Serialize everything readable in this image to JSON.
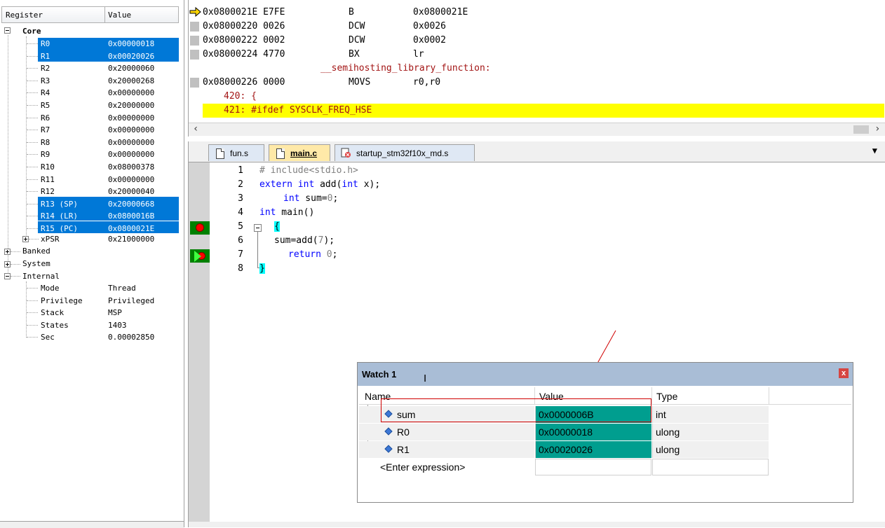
{
  "registers": {
    "headers": {
      "register": "Register",
      "value": "Value"
    },
    "core_label": "Core",
    "core": [
      {
        "name": "R0",
        "value": "0x00000018",
        "selected": true
      },
      {
        "name": "R1",
        "value": "0x00020026",
        "selected": true
      },
      {
        "name": "R2",
        "value": "0x20000060",
        "selected": false
      },
      {
        "name": "R3",
        "value": "0x20000268",
        "selected": false
      },
      {
        "name": "R4",
        "value": "0x00000000",
        "selected": false
      },
      {
        "name": "R5",
        "value": "0x20000000",
        "selected": false
      },
      {
        "name": "R6",
        "value": "0x00000000",
        "selected": false
      },
      {
        "name": "R7",
        "value": "0x00000000",
        "selected": false
      },
      {
        "name": "R8",
        "value": "0x00000000",
        "selected": false
      },
      {
        "name": "R9",
        "value": "0x00000000",
        "selected": false
      },
      {
        "name": "R10",
        "value": "0x08000378",
        "selected": false
      },
      {
        "name": "R11",
        "value": "0x00000000",
        "selected": false
      },
      {
        "name": "R12",
        "value": "0x20000040",
        "selected": false
      },
      {
        "name": "R13 (SP)",
        "value": "0x20000668",
        "selected": true
      },
      {
        "name": "R14 (LR)",
        "value": "0x0800016B",
        "selected": true
      },
      {
        "name": "R15 (PC)",
        "value": "0x0800021E",
        "selected": true
      }
    ],
    "xpsr": {
      "name": "xPSR",
      "value": "0x21000000"
    },
    "banked": "Banked",
    "system": "System",
    "internal_label": "Internal",
    "internal": [
      {
        "name": "Mode",
        "value": "Thread"
      },
      {
        "name": "Privilege",
        "value": "Privileged"
      },
      {
        "name": "Stack",
        "value": "MSP"
      },
      {
        "name": "States",
        "value": "1403"
      },
      {
        "name": "Sec",
        "value": "0.00002850"
      }
    ]
  },
  "disassembly": {
    "lines": [
      {
        "addr": "0x0800021E E7FE",
        "mnem": "B",
        "ops": "0x0800021E"
      },
      {
        "addr": "0x08000220 0026",
        "mnem": "DCW",
        "ops": "0x0026"
      },
      {
        "addr": "0x08000222 0002",
        "mnem": "DCW",
        "ops": "0x0002"
      },
      {
        "addr": "0x08000224 4770",
        "mnem": "BX",
        "ops": "lr"
      }
    ],
    "label": "__semihosting_library_function:",
    "line5": {
      "addr": "0x08000226 0000",
      "mnem": "MOVS",
      "ops": "r0,r0"
    },
    "src1": "420: {",
    "src2": "421: #ifdef SYSCLK_FREQ_HSE"
  },
  "tabs": [
    {
      "label": "fun.s"
    },
    {
      "label": "main.c"
    },
    {
      "label": "startup_stm32f10x_md.s"
    }
  ],
  "editor": {
    "line_numbers": [
      "1",
      "2",
      "3",
      "4",
      "5",
      "6",
      "7",
      "8"
    ],
    "l1": "# include<stdio.h>",
    "l2a": "extern int ",
    "l2b": "add(",
    "l2c": "int",
    "l2d": " x);",
    "l3a": "int",
    "l3b": " sum=",
    "l3c": "0",
    "l3d": ";",
    "l4a": "int",
    "l4b": " main()",
    "l5": "{",
    "l6a": "sum=add(",
    "l6b": "7",
    "l6c": ");",
    "l7a": "return",
    "l7b": " ",
    "l7c": "0",
    "l7d": ";",
    "l8": "}"
  },
  "watch": {
    "title": "Watch 1",
    "close": "x",
    "headers": {
      "name": "Name",
      "value": "Value",
      "type": "Type"
    },
    "rows": [
      {
        "name": "sum",
        "value": "0x0000006B",
        "type": "int"
      },
      {
        "name": "R0",
        "value": "0x00000018",
        "type": "ulong"
      },
      {
        "name": "R1",
        "value": "0x00020026",
        "type": "ulong"
      }
    ],
    "enter_expression": "<Enter expression>"
  },
  "colors": {
    "selection": "#0078d7",
    "watch_value_bg": "#009e8f",
    "current_line": "#ffff00",
    "annotation": "#d00000"
  }
}
